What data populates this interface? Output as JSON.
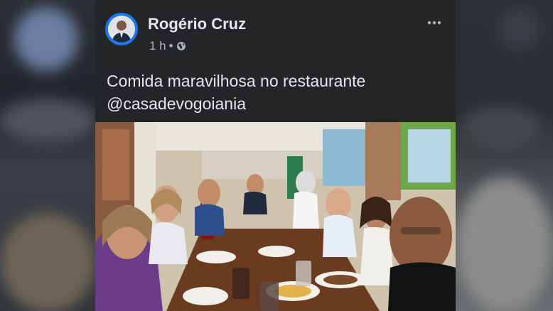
{
  "post": {
    "author": "Rogério Cruz",
    "time": "1 h",
    "separator": "•",
    "visibility_icon": "globe-icon",
    "more_icon": "more-options-icon",
    "caption_line1": "Comida maravilhosa no restaurante",
    "caption_line2": "@casadevogoiania"
  },
  "colors": {
    "card_bg": "#242526",
    "text_primary": "#e4e6eb",
    "text_secondary": "#b0b3b8",
    "avatar_ring": "#1877f2"
  }
}
